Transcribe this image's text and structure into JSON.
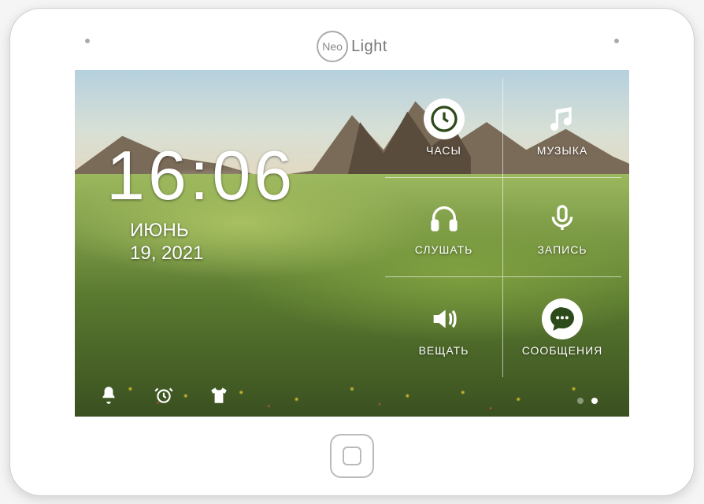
{
  "brand": {
    "circle": "Neo",
    "text": "Light"
  },
  "time": "16:06",
  "date_line1": "ИЮНЬ",
  "date_line2": "19, 2021",
  "menu": {
    "clock": {
      "label": "ЧАСЫ"
    },
    "music": {
      "label": "МУЗЫКА"
    },
    "listen": {
      "label": "СЛУШАТЬ"
    },
    "record": {
      "label": "ЗАПИСЬ"
    },
    "broadcast": {
      "label": "ВЕЩАТЬ"
    },
    "messages": {
      "label": "СООБЩЕНИЯ"
    }
  },
  "pagination": {
    "total": 2,
    "active_index": 1
  }
}
